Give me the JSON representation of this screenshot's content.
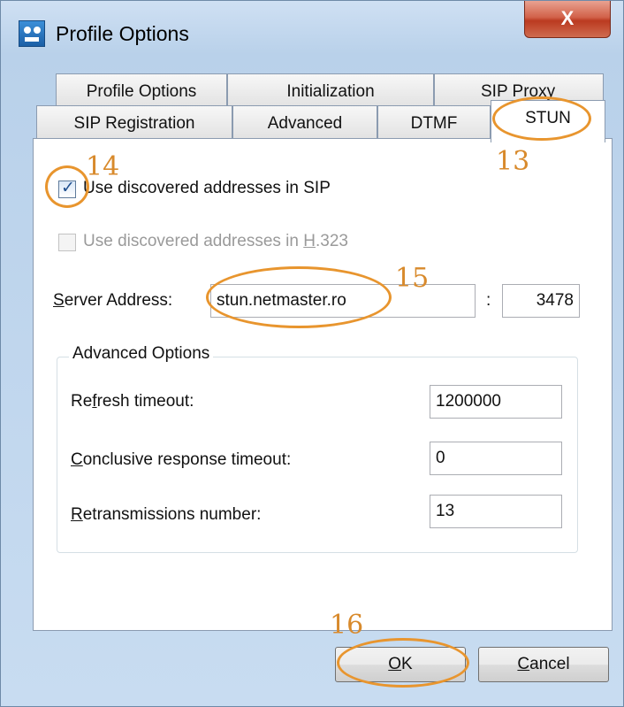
{
  "window": {
    "title": "Profile Options",
    "close_glyph": "X"
  },
  "tabs_row1": [
    {
      "label": "Profile Options"
    },
    {
      "label": "Initialization"
    },
    {
      "label": "SIP Proxy"
    }
  ],
  "tabs_row2": [
    {
      "label": "SIP Registration"
    },
    {
      "label": "Advanced"
    },
    {
      "label": "DTMF"
    },
    {
      "label": "STUN",
      "active": true
    }
  ],
  "stun": {
    "use_sip_label": "Use discovered addresses in SIP",
    "use_sip_checked": true,
    "use_h323_label_pre": "Use discovered addresses in ",
    "use_h323_label_ul": "H",
    "use_h323_label_post": ".323",
    "use_h323_checked": false,
    "server_label_ul": "S",
    "server_label_rest": "erver Address:",
    "server_value": "stun.netmaster.ro",
    "port_separator": ":",
    "port_value": "3478"
  },
  "advanced_options": {
    "title": "Advanced Options",
    "refresh_label_pre": "Re",
    "refresh_label_ul": "f",
    "refresh_label_post": "resh timeout:",
    "refresh_value": "1200000",
    "conclusive_label_ul": "C",
    "conclusive_label_rest": "onclusive response timeout:",
    "conclusive_value": "0",
    "retrans_label_ul": "R",
    "retrans_label_rest": "etransmissions number:",
    "retrans_value": "13"
  },
  "buttons": {
    "ok_ul": "O",
    "ok_rest": "K",
    "cancel_ul": "C",
    "cancel_rest": "ancel"
  },
  "annotations": [
    "13",
    "14",
    "15",
    "16"
  ],
  "colors": {
    "annotation": "#e8952e",
    "close_button": "#c94a30",
    "checkbox_mark": "#1f4f8f"
  }
}
